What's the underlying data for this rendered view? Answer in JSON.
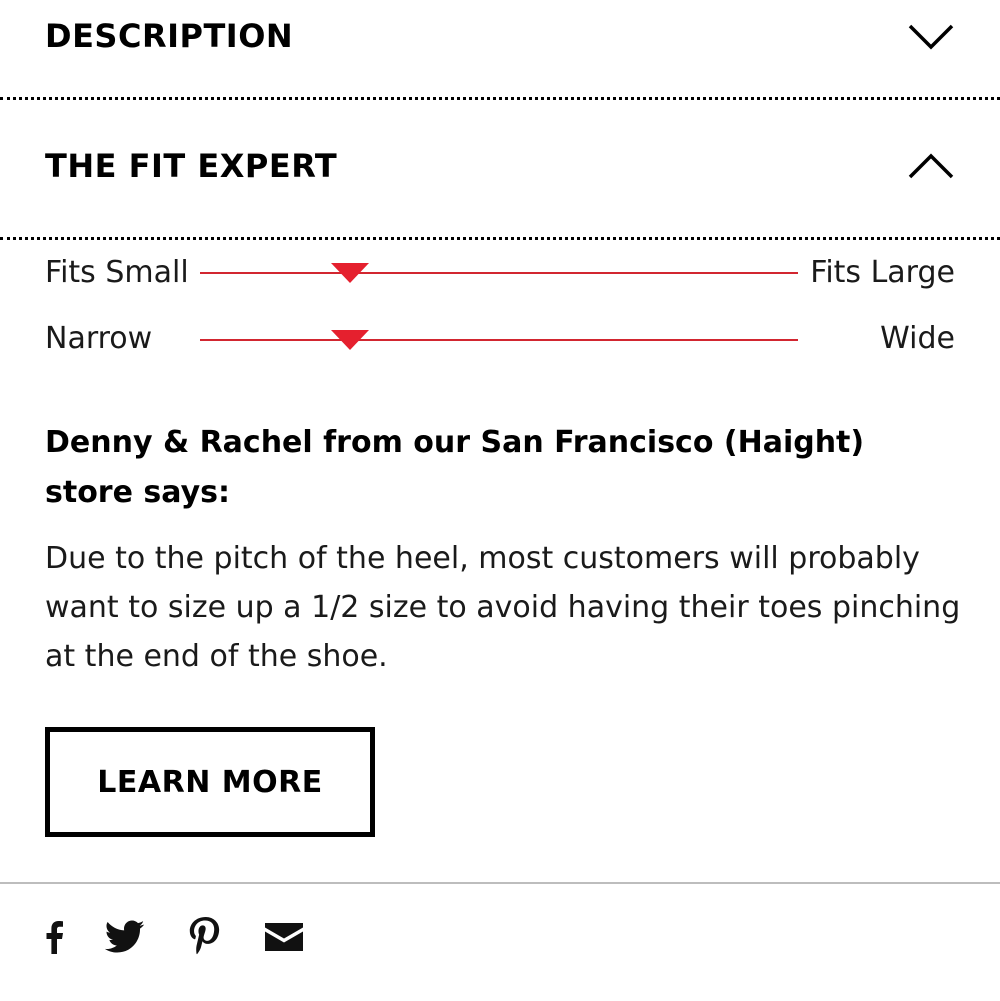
{
  "description_section": {
    "title": "DESCRIPTION",
    "icon": "chevron-down-icon"
  },
  "fit_expert_section": {
    "title": "THE FIT EXPERT",
    "icon": "chevron-up-icon",
    "scales": [
      {
        "left_label": "Fits Small",
        "right_label": "Fits Large",
        "value_fraction": 0.25
      },
      {
        "left_label": "Narrow",
        "right_label": "Wide",
        "value_fraction": 0.25
      }
    ],
    "accent_color": "#e5202e",
    "quote_title": "Denny & Rachel from our San Francisco (Haight) store says:",
    "quote_body": "Due to the pitch of the heel, most customers will probably want to size up a 1/2 size to avoid having their toes pinching at the end of the shoe.",
    "learn_more_label": "LEARN MORE"
  },
  "share": {
    "icons": [
      "facebook-icon",
      "twitter-icon",
      "pinterest-icon",
      "email-icon"
    ]
  }
}
